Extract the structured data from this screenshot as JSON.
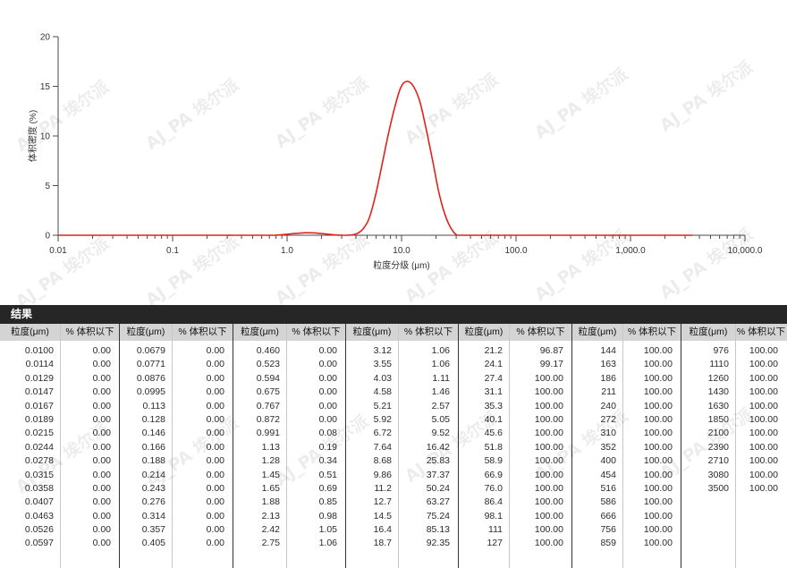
{
  "chart_data": {
    "type": "line",
    "xscale": "log",
    "xlim": [
      0.01,
      10000
    ],
    "ylim": [
      0,
      20
    ],
    "grid": false,
    "xlabel": "粒度分级 (μm)",
    "ylabel": "体积密度 (%)",
    "xticks": [
      0.01,
      0.1,
      1,
      10,
      100,
      1000,
      10000
    ],
    "xtick_labels": [
      "0.01",
      "0.1",
      "1.0",
      "10.0",
      "100.0",
      "1,000.0",
      "10,000.0"
    ],
    "yticks": [
      0,
      5,
      10,
      15,
      20
    ],
    "ytick_labels": [
      "0",
      "5",
      "10",
      "15",
      "20"
    ],
    "series": [
      {
        "color": "#e3211e",
        "x": [
          0.01,
          0.1,
          0.46,
          0.767,
          0.872,
          0.991,
          1.13,
          1.28,
          1.45,
          1.65,
          1.88,
          2.13,
          2.42,
          2.75,
          3.12,
          3.55,
          4.03,
          4.58,
          5.21,
          5.92,
          6.72,
          7.64,
          8.68,
          9.86,
          11.2,
          12.7,
          14.5,
          16.4,
          18.7,
          21.2,
          24.1,
          27.4,
          31.1,
          100,
          1000,
          3500
        ],
        "y": [
          0,
          0,
          0,
          0,
          0.04,
          0.1,
          0.16,
          0.21,
          0.25,
          0.24,
          0.2,
          0.14,
          0.07,
          0.02,
          0,
          0.02,
          0.15,
          0.6,
          1.7,
          4.0,
          7.0,
          10.1,
          12.8,
          14.9,
          15.5,
          15.0,
          13.4,
          10.7,
          7.5,
          4.3,
          2.0,
          0.6,
          0,
          0,
          0,
          0
        ]
      }
    ]
  },
  "results": {
    "title": "结果",
    "col_size": "粒度(μm)",
    "col_pct": "% 体积以下",
    "groups": [
      [
        [
          "0.0100",
          "0.00"
        ],
        [
          "0.0114",
          "0.00"
        ],
        [
          "0.0129",
          "0.00"
        ],
        [
          "0.0147",
          "0.00"
        ],
        [
          "0.0167",
          "0.00"
        ],
        [
          "0.0189",
          "0.00"
        ],
        [
          "0.0215",
          "0.00"
        ],
        [
          "0.0244",
          "0.00"
        ],
        [
          "0.0278",
          "0.00"
        ],
        [
          "0.0315",
          "0.00"
        ],
        [
          "0.0358",
          "0.00"
        ],
        [
          "0.0407",
          "0.00"
        ],
        [
          "0.0463",
          "0.00"
        ],
        [
          "0.0526",
          "0.00"
        ],
        [
          "0.0597",
          "0.00"
        ]
      ],
      [
        [
          "0.0679",
          "0.00"
        ],
        [
          "0.0771",
          "0.00"
        ],
        [
          "0.0876",
          "0.00"
        ],
        [
          "0.0995",
          "0.00"
        ],
        [
          "0.113",
          "0.00"
        ],
        [
          "0.128",
          "0.00"
        ],
        [
          "0.146",
          "0.00"
        ],
        [
          "0.166",
          "0.00"
        ],
        [
          "0.188",
          "0.00"
        ],
        [
          "0.214",
          "0.00"
        ],
        [
          "0.243",
          "0.00"
        ],
        [
          "0.276",
          "0.00"
        ],
        [
          "0.314",
          "0.00"
        ],
        [
          "0.357",
          "0.00"
        ],
        [
          "0.405",
          "0.00"
        ]
      ],
      [
        [
          "0.460",
          "0.00"
        ],
        [
          "0.523",
          "0.00"
        ],
        [
          "0.594",
          "0.00"
        ],
        [
          "0.675",
          "0.00"
        ],
        [
          "0.767",
          "0.00"
        ],
        [
          "0.872",
          "0.00"
        ],
        [
          "0.991",
          "0.08"
        ],
        [
          "1.13",
          "0.19"
        ],
        [
          "1.28",
          "0.34"
        ],
        [
          "1.45",
          "0.51"
        ],
        [
          "1.65",
          "0.69"
        ],
        [
          "1.88",
          "0.85"
        ],
        [
          "2.13",
          "0.98"
        ],
        [
          "2.42",
          "1.05"
        ],
        [
          "2.75",
          "1.06"
        ]
      ],
      [
        [
          "3.12",
          "1.06"
        ],
        [
          "3.55",
          "1.06"
        ],
        [
          "4.03",
          "1.11"
        ],
        [
          "4.58",
          "1.46"
        ],
        [
          "5.21",
          "2.57"
        ],
        [
          "5.92",
          "5.05"
        ],
        [
          "6.72",
          "9.52"
        ],
        [
          "7.64",
          "16.42"
        ],
        [
          "8.68",
          "25.83"
        ],
        [
          "9.86",
          "37.37"
        ],
        [
          "11.2",
          "50.24"
        ],
        [
          "12.7",
          "63.27"
        ],
        [
          "14.5",
          "75.24"
        ],
        [
          "16.4",
          "85.13"
        ],
        [
          "18.7",
          "92.35"
        ]
      ],
      [
        [
          "21.2",
          "96.87"
        ],
        [
          "24.1",
          "99.17"
        ],
        [
          "27.4",
          "100.00"
        ],
        [
          "31.1",
          "100.00"
        ],
        [
          "35.3",
          "100.00"
        ],
        [
          "40.1",
          "100.00"
        ],
        [
          "45.6",
          "100.00"
        ],
        [
          "51.8",
          "100.00"
        ],
        [
          "58.9",
          "100.00"
        ],
        [
          "66.9",
          "100.00"
        ],
        [
          "76.0",
          "100.00"
        ],
        [
          "86.4",
          "100.00"
        ],
        [
          "98.1",
          "100.00"
        ],
        [
          "111",
          "100.00"
        ],
        [
          "127",
          "100.00"
        ]
      ],
      [
        [
          "144",
          "100.00"
        ],
        [
          "163",
          "100.00"
        ],
        [
          "186",
          "100.00"
        ],
        [
          "211",
          "100.00"
        ],
        [
          "240",
          "100.00"
        ],
        [
          "272",
          "100.00"
        ],
        [
          "310",
          "100.00"
        ],
        [
          "352",
          "100.00"
        ],
        [
          "400",
          "100.00"
        ],
        [
          "454",
          "100.00"
        ],
        [
          "516",
          "100.00"
        ],
        [
          "586",
          "100.00"
        ],
        [
          "666",
          "100.00"
        ],
        [
          "756",
          "100.00"
        ],
        [
          "859",
          "100.00"
        ]
      ],
      [
        [
          "976",
          "100.00"
        ],
        [
          "1110",
          "100.00"
        ],
        [
          "1260",
          "100.00"
        ],
        [
          "1430",
          "100.00"
        ],
        [
          "1630",
          "100.00"
        ],
        [
          "1850",
          "100.00"
        ],
        [
          "2100",
          "100.00"
        ],
        [
          "2390",
          "100.00"
        ],
        [
          "2710",
          "100.00"
        ],
        [
          "3080",
          "100.00"
        ],
        [
          "3500",
          "100.00"
        ]
      ]
    ]
  },
  "watermark": {
    "text": "AJ_PA 埃尔派"
  }
}
